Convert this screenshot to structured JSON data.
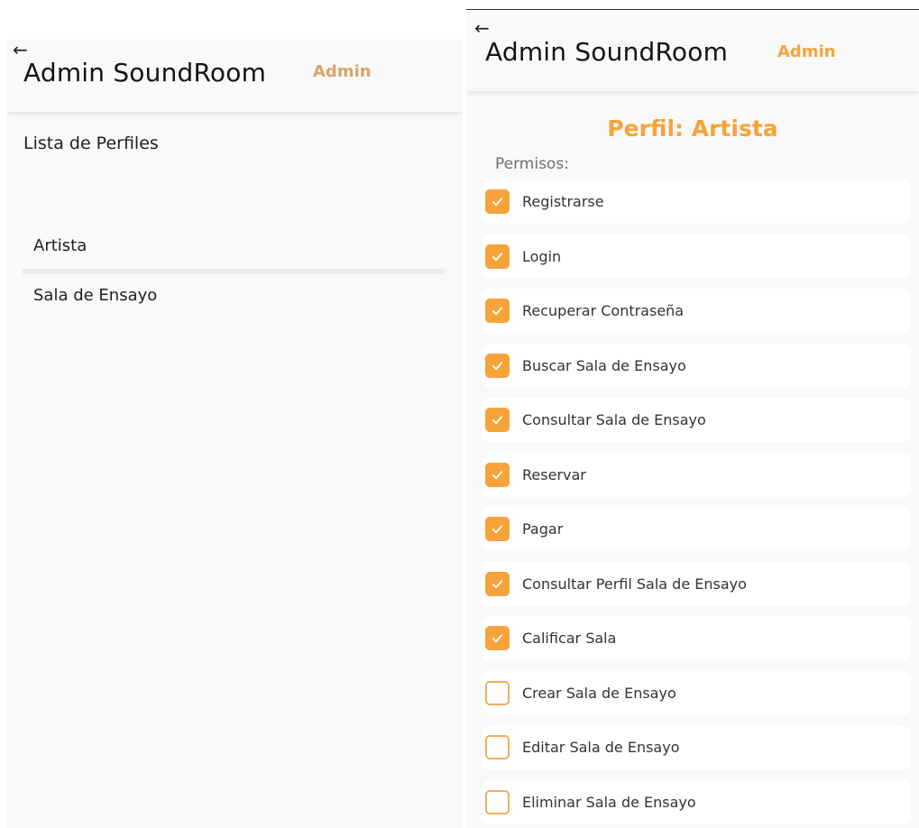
{
  "left": {
    "header": {
      "back_icon": "arrow-left-icon",
      "title": "Admin SoundRoom",
      "role": "Admin"
    },
    "section_label": "Lista de Perfiles",
    "profiles": [
      {
        "label": "Artista"
      },
      {
        "label": "Sala de Ensayo"
      }
    ]
  },
  "right": {
    "header": {
      "back_icon": "arrow-left-icon",
      "title": "Admin SoundRoom",
      "role": "Admin"
    },
    "profile_title": "Perfil: Artista",
    "permissions_label": "Permisos:",
    "permissions": [
      {
        "label": "Registrarse",
        "checked": true
      },
      {
        "label": "Login",
        "checked": true
      },
      {
        "label": "Recuperar Contraseña",
        "checked": true
      },
      {
        "label": "Buscar Sala de Ensayo",
        "checked": true
      },
      {
        "label": "Consultar Sala de Ensayo",
        "checked": true
      },
      {
        "label": "Reservar",
        "checked": true
      },
      {
        "label": "Pagar",
        "checked": true
      },
      {
        "label": "Consultar Perfil Sala de Ensayo",
        "checked": true
      },
      {
        "label": "Calificar Sala",
        "checked": true
      },
      {
        "label": "Crear Sala de Ensayo",
        "checked": false
      },
      {
        "label": "Editar Sala de Ensayo",
        "checked": false
      },
      {
        "label": "Eliminar Sala de Ensayo",
        "checked": false
      }
    ]
  },
  "colors": {
    "accent": "#f7a33a",
    "muted_accent": "#d9a36a",
    "panel_bg": "#f9f9f9"
  }
}
